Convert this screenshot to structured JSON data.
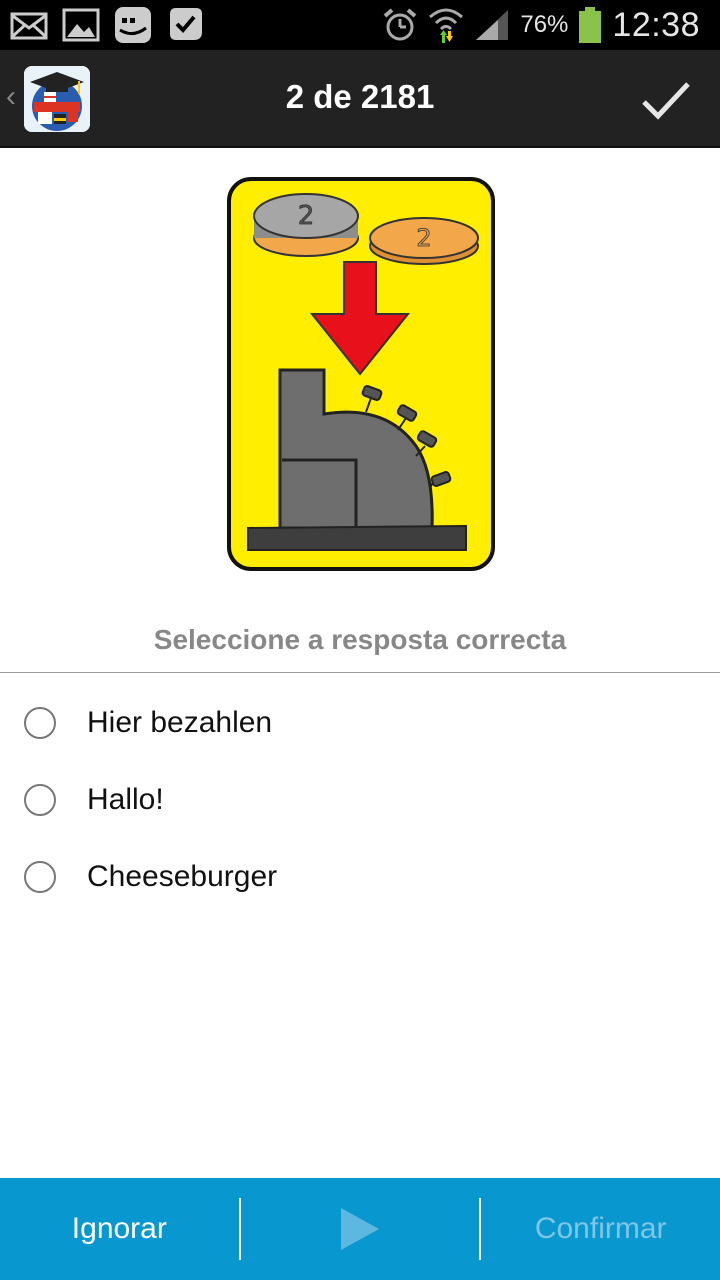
{
  "status_bar": {
    "battery_percent": "76%",
    "time": "12:38",
    "icons": [
      "mail-icon",
      "image-icon",
      "chat-icon",
      "checkmark-badge-icon",
      "alarm-icon",
      "wifi-icon",
      "signal-icon",
      "battery-icon"
    ]
  },
  "action_bar": {
    "title": "2 de 2181",
    "app_icon": "language-globe-icon",
    "confirm_icon": "check-icon"
  },
  "question": {
    "prompt": "Seleccione a resposta correcta",
    "image": "cash-register-with-coins-card",
    "options": [
      {
        "label": "Hier bezahlen",
        "selected": false
      },
      {
        "label": "Hallo!",
        "selected": false
      },
      {
        "label": "Cheeseburger",
        "selected": false
      }
    ]
  },
  "bottom_bar": {
    "ignore_label": "Ignorar",
    "play_icon": "play-icon",
    "confirm_label": "Confirmar",
    "colors": {
      "background": "#0997cf",
      "disabled_text": "#7fc6e6"
    }
  }
}
